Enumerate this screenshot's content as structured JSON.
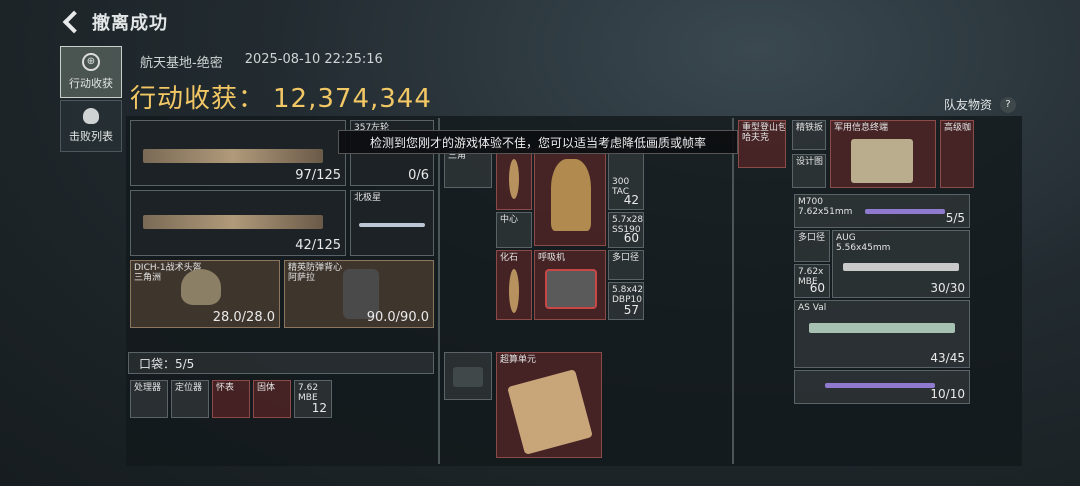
{
  "header": {
    "title": "撤离成功"
  },
  "sidebar": {
    "tabs": [
      {
        "label": "行动收获",
        "icon": "loot-icon",
        "active": true
      },
      {
        "label": "击败列表",
        "icon": "skull-icon",
        "active": false
      }
    ]
  },
  "meta": {
    "map": "航天基地-绝密",
    "datetime": "2025-08-10 22:25:16"
  },
  "total": {
    "label": "行动收获：",
    "value": "12,374,344"
  },
  "teammates": {
    "label": "队友物资",
    "help": "?"
  },
  "tooltip": "检测到您刚才的游戏体验不佳，您可以适当考虑降低画质或帧率",
  "equip": {
    "primary": {
      "count": "97/125"
    },
    "ammo": {
      "label": "357左轮",
      "count": "0/6"
    },
    "secondary": {
      "count": "42/125"
    },
    "melee": {
      "label": "北极星"
    },
    "helmet": {
      "label": "DICH-1战术头盔\n三角洲",
      "count": "28.0/28.0"
    },
    "vest": {
      "label": "精英防弹背心\n阿萨拉",
      "count": "90.0/90.0"
    }
  },
  "pocket": {
    "label": "口袋：5/5",
    "items": [
      {
        "label": "处理器"
      },
      {
        "label": "定位器"
      },
      {
        "label": "怀表"
      },
      {
        "label": "固体"
      },
      {
        "label": "7.62\nMBE",
        "count": "12"
      }
    ]
  },
  "backpack": {
    "items": [
      {
        "label": "三角"
      },
      {
        "label": ""
      },
      {
        "label": "中心"
      },
      {
        "label": "化石"
      },
      {
        "label": "呼吸机"
      },
      {
        "label": "300\nTAC",
        "count": "42"
      },
      {
        "label": "5.7x28\nSS190",
        "count": "60"
      },
      {
        "label": "多口径"
      },
      {
        "label": "5.8x42\nDBP10",
        "count": "57"
      },
      {
        "label": "超算单元"
      }
    ]
  },
  "right": {
    "items": [
      {
        "label": "重型登山包\n哈夫克"
      },
      {
        "label": "精铁扳"
      },
      {
        "label": "设计图"
      },
      {
        "label": "军用信息终端"
      },
      {
        "label": "高级咖"
      },
      {
        "label": "M700\n7.62x51mm",
        "count": "5/5"
      },
      {
        "label": "多口径"
      },
      {
        "label": "AUG\n5.56x45mm"
      },
      {
        "label": "7.62x\nMBE",
        "count": "60"
      },
      {
        "label": "",
        "count": "30/30"
      },
      {
        "label": "AS Val",
        "count": "43/45"
      },
      {
        "label": "",
        "count": "10/10"
      }
    ]
  },
  "colors": {
    "accent": "#f2c765"
  }
}
